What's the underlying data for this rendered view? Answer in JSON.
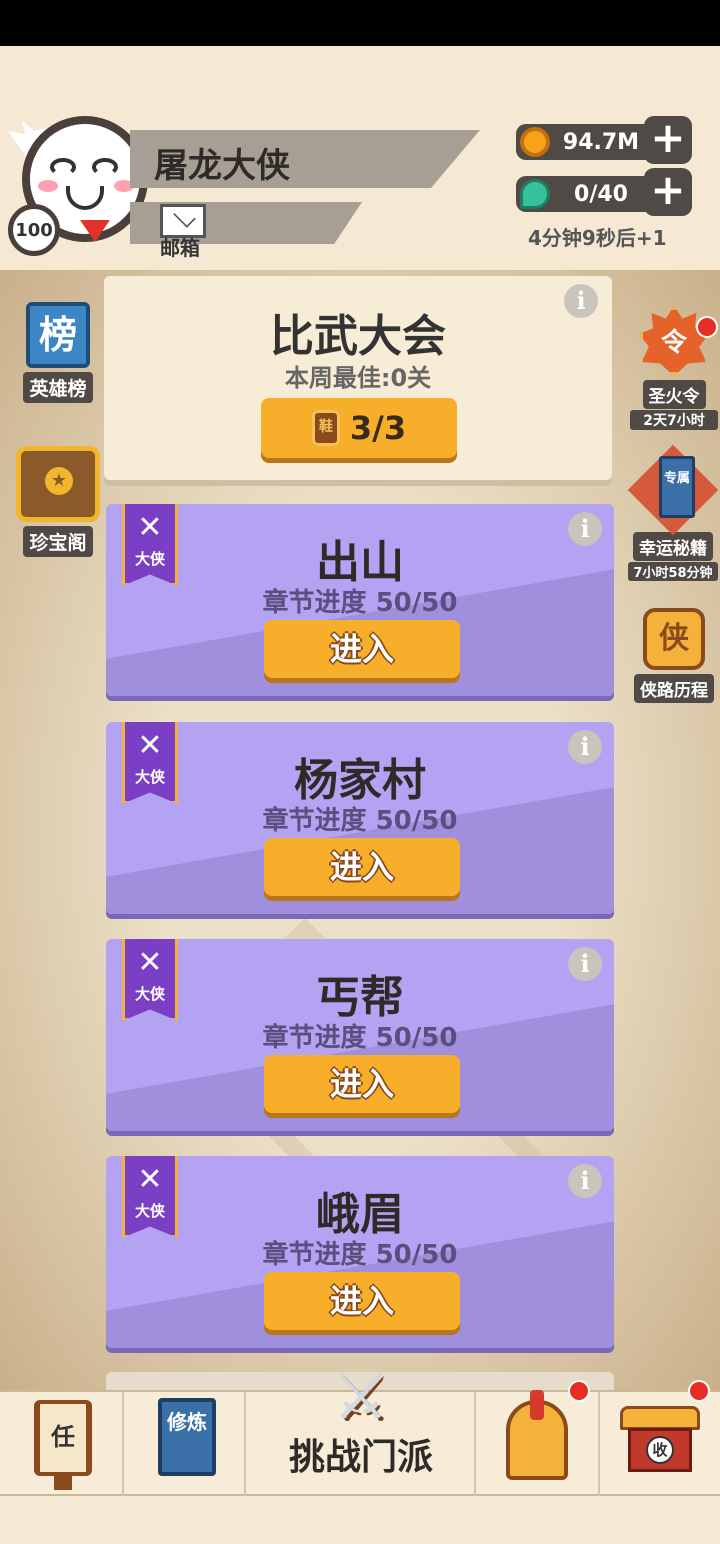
{
  "player": {
    "name": "屠龙大侠",
    "level": "100",
    "mail_label": "邮箱"
  },
  "resources": {
    "gold": "94.7M",
    "gems": "0/40",
    "timer": "4分钟9秒后+1"
  },
  "left_menu": {
    "rank_icon_text": "榜",
    "rank_label": "英雄榜",
    "treasure_label": "珍宝阁"
  },
  "right_menu": {
    "fire_icon_text": "令",
    "fire_label": "圣火令",
    "fire_timer": "2天7小时",
    "book_icon_text": "专属",
    "book_label": "幸运秘籍",
    "book_timer": "7小时58分钟",
    "journey_icon_text": "侠",
    "journey_label": "侠路历程"
  },
  "tournament": {
    "title": "比武大会",
    "best": "本周最佳:0关",
    "ticket_icon_text": "鞋",
    "tickets": "3/3"
  },
  "chapters": [
    {
      "rank": "大侠",
      "title": "出山",
      "progress": "章节进度 50/50",
      "enter": "进入"
    },
    {
      "rank": "大侠",
      "title": "杨家村",
      "progress": "章节进度 50/50",
      "enter": "进入"
    },
    {
      "rank": "大侠",
      "title": "丐帮",
      "progress": "章节进度 50/50",
      "enter": "进入"
    },
    {
      "rank": "大侠",
      "title": "峨眉",
      "progress": "章节进度 50/50",
      "enter": "进入"
    }
  ],
  "info_glyph": "i",
  "bottom_nav": {
    "task_icon_text": "任",
    "cultivate_icon_text": "修炼",
    "challenge_label": "挑战门派",
    "shop_icon_text": "收"
  },
  "colors": {
    "background": "#f5e9d3",
    "chapter_card": "#b4a2f2",
    "button_orange": "#f6ae2b",
    "notification_red": "#e62d23"
  }
}
